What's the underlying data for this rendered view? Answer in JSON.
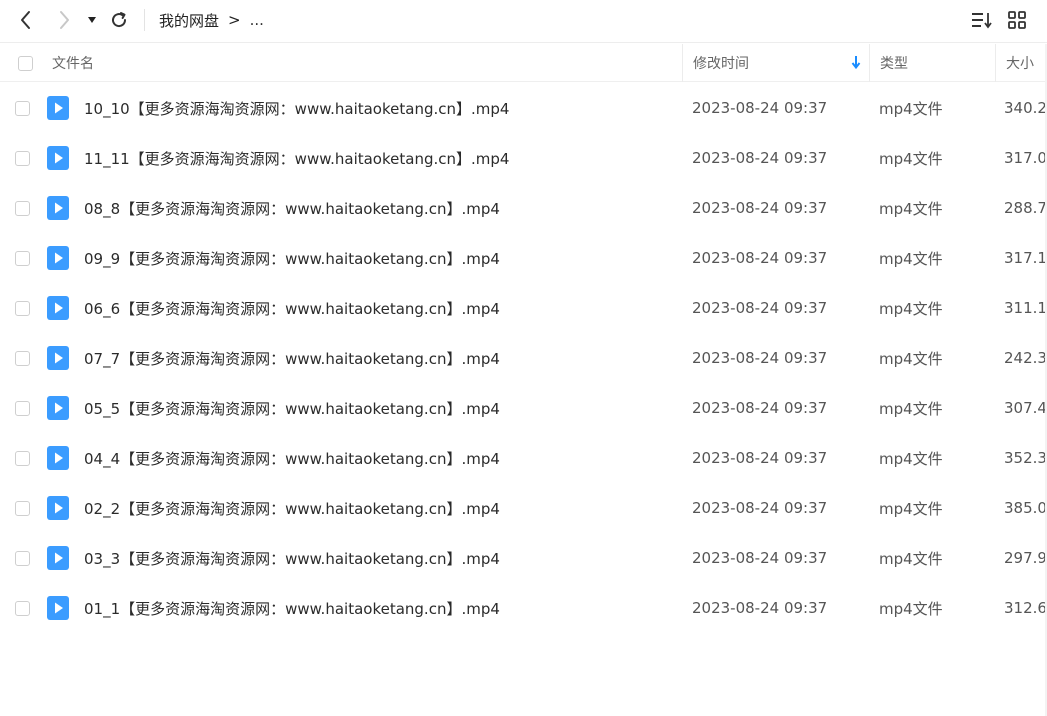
{
  "toolbar": {
    "breadcrumb_root": "我的网盘",
    "breadcrumb_sep": ">",
    "breadcrumb_more": "..."
  },
  "columns": {
    "name": "文件名",
    "modified": "修改时间",
    "type": "类型",
    "size": "大小"
  },
  "files": [
    {
      "name": "10_10【更多资源海淘资源网：www.haitaoketang.cn】.mp4",
      "modified": "2023-08-24 09:37",
      "type": "mp4文件",
      "size": "340.2"
    },
    {
      "name": "11_11【更多资源海淘资源网：www.haitaoketang.cn】.mp4",
      "modified": "2023-08-24 09:37",
      "type": "mp4文件",
      "size": "317.0"
    },
    {
      "name": "08_8【更多资源海淘资源网：www.haitaoketang.cn】.mp4",
      "modified": "2023-08-24 09:37",
      "type": "mp4文件",
      "size": "288.7"
    },
    {
      "name": "09_9【更多资源海淘资源网：www.haitaoketang.cn】.mp4",
      "modified": "2023-08-24 09:37",
      "type": "mp4文件",
      "size": "317.1"
    },
    {
      "name": "06_6【更多资源海淘资源网：www.haitaoketang.cn】.mp4",
      "modified": "2023-08-24 09:37",
      "type": "mp4文件",
      "size": "311.1"
    },
    {
      "name": "07_7【更多资源海淘资源网：www.haitaoketang.cn】.mp4",
      "modified": "2023-08-24 09:37",
      "type": "mp4文件",
      "size": "242.3"
    },
    {
      "name": "05_5【更多资源海淘资源网：www.haitaoketang.cn】.mp4",
      "modified": "2023-08-24 09:37",
      "type": "mp4文件",
      "size": "307.4"
    },
    {
      "name": "04_4【更多资源海淘资源网：www.haitaoketang.cn】.mp4",
      "modified": "2023-08-24 09:37",
      "type": "mp4文件",
      "size": "352.3"
    },
    {
      "name": "02_2【更多资源海淘资源网：www.haitaoketang.cn】.mp4",
      "modified": "2023-08-24 09:37",
      "type": "mp4文件",
      "size": "385.0"
    },
    {
      "name": "03_3【更多资源海淘资源网：www.haitaoketang.cn】.mp4",
      "modified": "2023-08-24 09:37",
      "type": "mp4文件",
      "size": "297.9"
    },
    {
      "name": "01_1【更多资源海淘资源网：www.haitaoketang.cn】.mp4",
      "modified": "2023-08-24 09:37",
      "type": "mp4文件",
      "size": "312.6"
    }
  ],
  "icons": {
    "back": "chevron-left-icon",
    "forward": "chevron-right-icon",
    "history": "caret-down-icon",
    "refresh": "refresh-icon",
    "sort": "sort-icon",
    "grid_view": "grid-view-icon",
    "sort_direction": "arrow-down-icon",
    "file": "video-file-icon"
  },
  "colors": {
    "accent": "#1a8cff",
    "file_icon": "#3b9cff"
  }
}
